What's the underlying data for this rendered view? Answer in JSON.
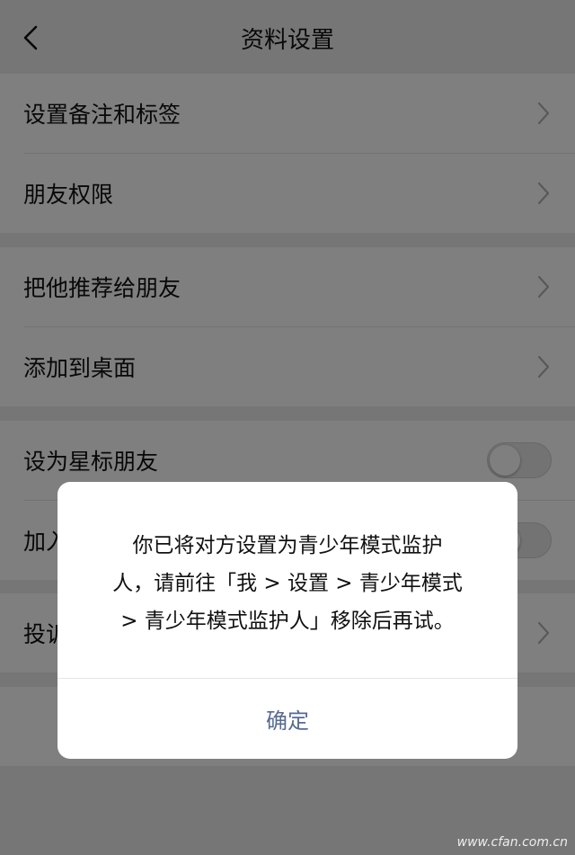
{
  "header": {
    "title": "资料设置",
    "back_icon": "chevron-left-icon"
  },
  "groups": [
    {
      "items": [
        {
          "label": "设置备注和标签",
          "type": "arrow"
        },
        {
          "label": "朋友权限",
          "type": "arrow"
        }
      ]
    },
    {
      "items": [
        {
          "label": "把他推荐给朋友",
          "type": "arrow"
        },
        {
          "label": "添加到桌面",
          "type": "arrow"
        }
      ]
    },
    {
      "items": [
        {
          "label": "设为星标朋友",
          "type": "toggle",
          "on": false
        },
        {
          "label": "加入黑名单",
          "type": "toggle",
          "on": false
        }
      ]
    },
    {
      "items": [
        {
          "label": "投诉",
          "type": "arrow"
        }
      ]
    }
  ],
  "dialog": {
    "message_lines": [
      "你已将对方设置为青少年模式监护",
      "人，请前往「我 > 设置 > 青少年模式",
      "> 青少年模式监护人」移除后再试。"
    ],
    "confirm_label": "确定"
  },
  "watermark": "www.cfan.com.cn",
  "colors": {
    "link": "#576b95",
    "overlay": "rgba(0,0,0,0.5)",
    "background": "#ededed"
  }
}
